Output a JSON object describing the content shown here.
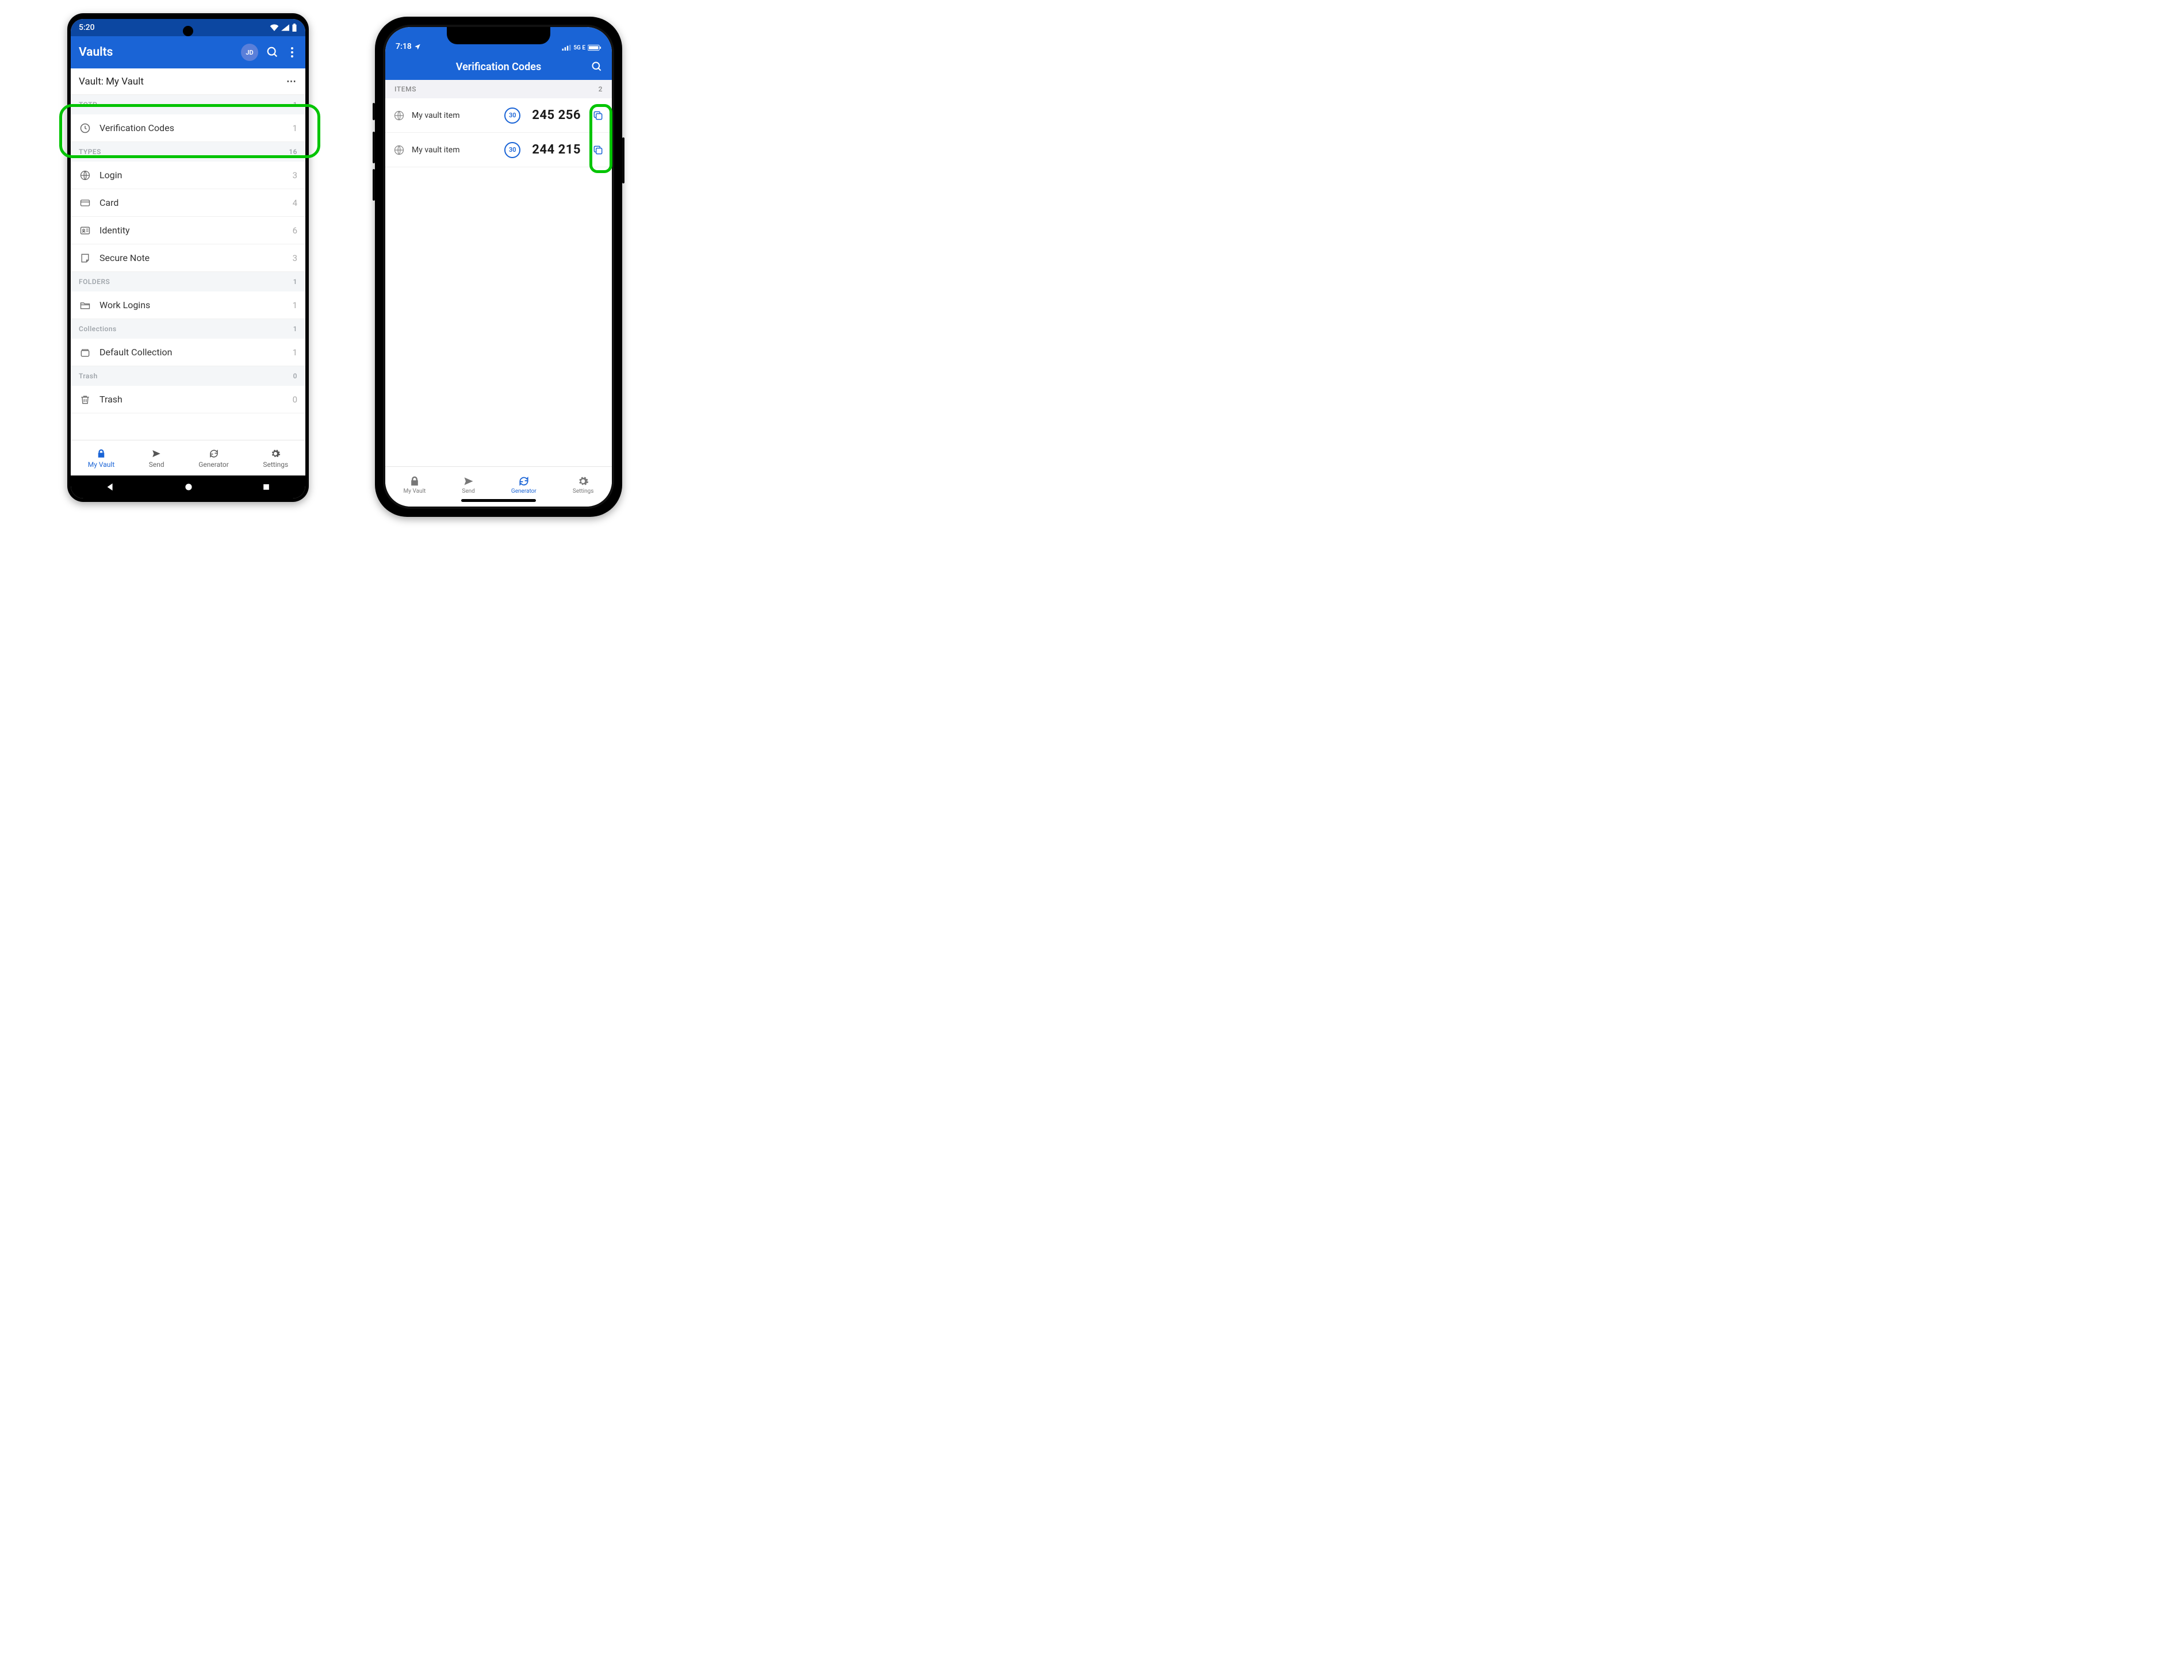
{
  "android": {
    "status_time": "5:20",
    "appbar_title": "Vaults",
    "avatar_initials": "JD",
    "vault_label": "Vault: My Vault",
    "sections": {
      "totp": {
        "title": "TOTP",
        "count": "1",
        "rows": [
          {
            "label": "Verification Codes",
            "count": "1"
          }
        ]
      },
      "types": {
        "title": "TYPES",
        "count": "16",
        "rows": [
          {
            "label": "Login",
            "count": "3"
          },
          {
            "label": "Card",
            "count": "4"
          },
          {
            "label": "Identity",
            "count": "6"
          },
          {
            "label": "Secure Note",
            "count": "3"
          }
        ]
      },
      "folders": {
        "title": "FOLDERS",
        "count": "1",
        "rows": [
          {
            "label": "Work Logins",
            "count": "1"
          }
        ]
      },
      "collections": {
        "title": "Collections",
        "count": "1",
        "rows": [
          {
            "label": "Default Collection",
            "count": "1"
          }
        ]
      },
      "trash": {
        "title": "Trash",
        "count": "0",
        "rows": [
          {
            "label": "Trash",
            "count": "0"
          }
        ]
      }
    },
    "tabs": {
      "vault": "My Vault",
      "send": "Send",
      "generator": "Generator",
      "settings": "Settings"
    }
  },
  "iphone": {
    "status_time": "7:18",
    "status_network": "5G E",
    "appbar_title": "Verification Codes",
    "section_title": "ITEMS",
    "section_count": "2",
    "items": [
      {
        "name": "My vault item",
        "timer": "30",
        "code": "245 256"
      },
      {
        "name": "My vault item",
        "timer": "30",
        "code": "244 215"
      }
    ],
    "tabs": {
      "vault": "My Vault",
      "send": "Send",
      "generator": "Generator",
      "settings": "Settings"
    }
  }
}
